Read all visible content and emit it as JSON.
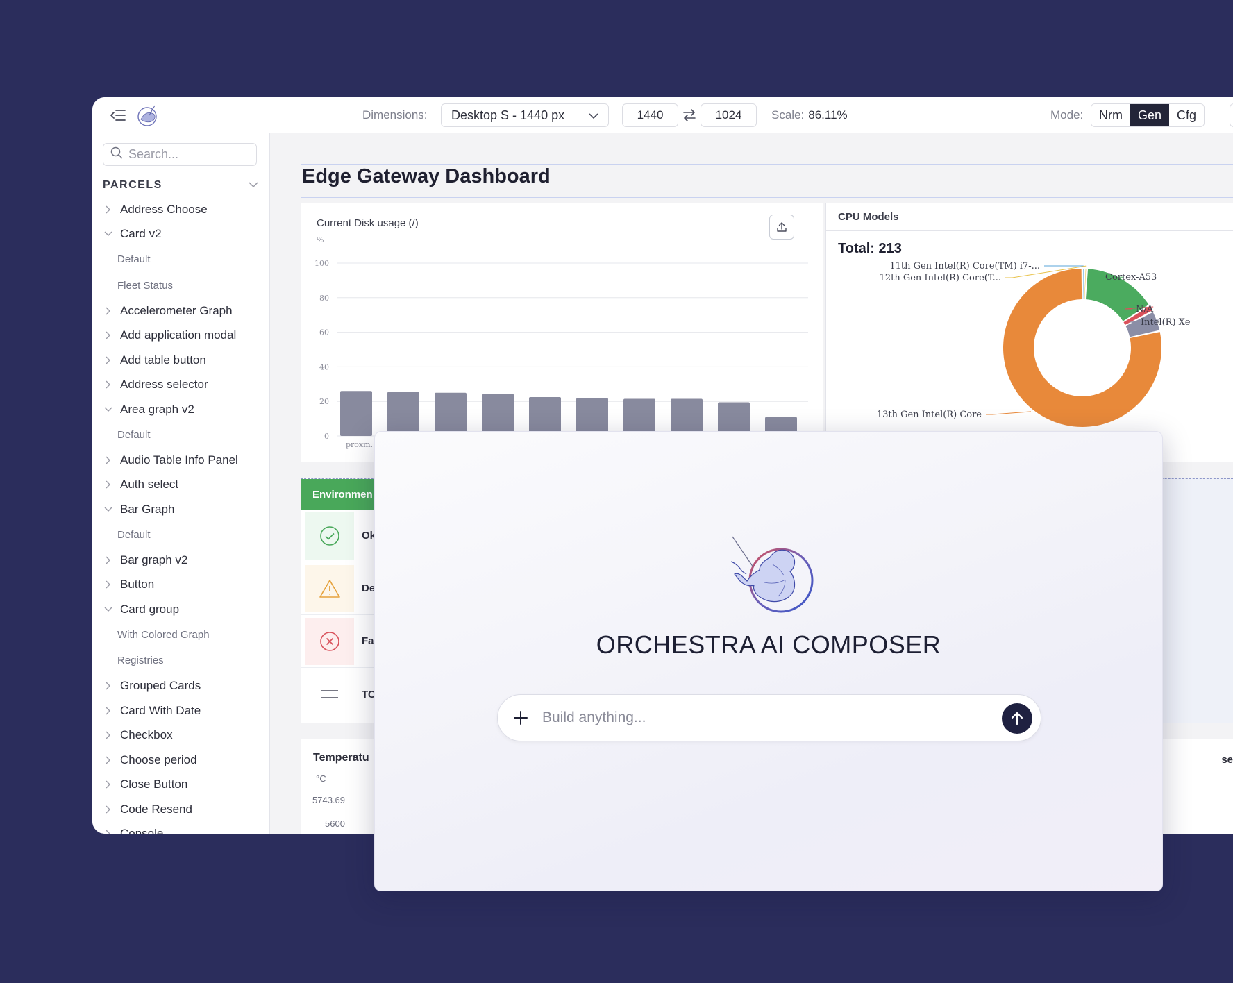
{
  "topbar": {
    "dimensions_label": "Dimensions:",
    "dimensions_value": "Desktop S - 1440 px",
    "width": "1440",
    "height": "1024",
    "scale_label": "Scale:",
    "scale_value": "86.11%",
    "mode_label": "Mode:",
    "modes": [
      "Nrm",
      "Gen",
      "Cfg"
    ],
    "active_mode": "Gen"
  },
  "sidebar": {
    "search_placeholder": "Search...",
    "section": "PARCELS",
    "items": [
      {
        "label": "Address Choose",
        "type": "collapsed"
      },
      {
        "label": "Card v2",
        "type": "expanded"
      },
      {
        "label": "Default",
        "type": "sub"
      },
      {
        "label": "Fleet Status",
        "type": "sub"
      },
      {
        "label": "Accelerometer Graph",
        "type": "collapsed"
      },
      {
        "label": "Add application modal",
        "type": "collapsed"
      },
      {
        "label": "Add table button",
        "type": "collapsed"
      },
      {
        "label": "Address selector",
        "type": "collapsed"
      },
      {
        "label": "Area graph v2",
        "type": "expanded"
      },
      {
        "label": "Default",
        "type": "sub"
      },
      {
        "label": "Audio Table Info Panel",
        "type": "collapsed"
      },
      {
        "label": "Auth select",
        "type": "collapsed"
      },
      {
        "label": "Bar Graph",
        "type": "expanded"
      },
      {
        "label": "Default",
        "type": "sub"
      },
      {
        "label": "Bar graph v2",
        "type": "collapsed"
      },
      {
        "label": "Button",
        "type": "collapsed"
      },
      {
        "label": "Card group",
        "type": "expanded"
      },
      {
        "label": "With Colored Graph",
        "type": "sub"
      },
      {
        "label": "Registries",
        "type": "sub"
      },
      {
        "label": "Grouped Cards",
        "type": "collapsed"
      },
      {
        "label": "Card With Date",
        "type": "collapsed"
      },
      {
        "label": "Checkbox",
        "type": "collapsed"
      },
      {
        "label": "Choose period",
        "type": "collapsed"
      },
      {
        "label": "Close Button",
        "type": "collapsed"
      },
      {
        "label": "Code Resend",
        "type": "collapsed"
      },
      {
        "label": "Console",
        "type": "collapsed"
      }
    ]
  },
  "dashboard": {
    "title": "Edge Gateway Dashboard",
    "disk_card_title": "Current Disk usage (/)",
    "cpu_card_title": "CPU Models",
    "cpu_total": "Total: 213",
    "env_head": "Environmen",
    "env_rows": [
      {
        "label": "Ok",
        "icon": "check-circle-icon"
      },
      {
        "label": "Deg",
        "icon": "warning-icon"
      },
      {
        "label": "Fail",
        "icon": "x-circle-icon"
      },
      {
        "label": "TOT",
        "icon": "equals-icon"
      }
    ],
    "temp_title": "Temperatu",
    "temp_unit": "°C",
    "temp_tick_1": "5743.69",
    "temp_tick_2": "5600",
    "right_card_label": "se"
  },
  "chart_data": [
    {
      "type": "bar",
      "title": "Current Disk usage (/)",
      "ylabel": "%",
      "ylim": [
        0,
        100
      ],
      "yticks": [
        0,
        20,
        40,
        60,
        80,
        100
      ],
      "first_category_label": "proxm...",
      "values": [
        26,
        25.5,
        25,
        24.5,
        22.5,
        22,
        21.5,
        21.5,
        19.5,
        11
      ],
      "color": "#888a9e",
      "grid": true
    },
    {
      "type": "pie",
      "title": "CPU Models",
      "subtitle": "Total: 213",
      "labels": [
        "11th Gen Intel(R) Core(TM) i7-...",
        "12th Gen Intel(R) Core(T...",
        "Cortex-A53",
        "N/A",
        "Intel(R) Xe",
        "13th Gen Intel(R) Core"
      ],
      "values": [
        1,
        1,
        32,
        3,
        9,
        167
      ],
      "colors": [
        "#5aa5d8",
        "#e8c24a",
        "#4bab5f",
        "#d9515b",
        "#8b8ea6",
        "#e8893a"
      ]
    }
  ],
  "modal": {
    "title": "ORCHESTRA AI COMPOSER",
    "prompt_placeholder": "Build anything..."
  }
}
